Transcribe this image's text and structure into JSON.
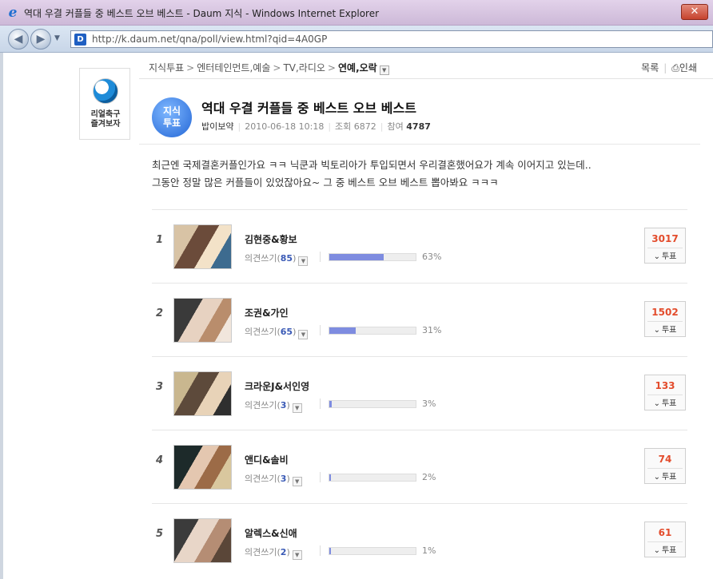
{
  "window": {
    "title": "역대 우결 커플들 중 베스트 오브 베스트 - Daum 지식 - Windows Internet Explorer",
    "url_domain": "http://k.daum.net",
    "url_path": "/qna/poll/view.html?qid=4A0GP",
    "close_label": "✕"
  },
  "side_badge": {
    "line1": "리얼축구",
    "line2": "즐겨보자"
  },
  "breadcrumb": {
    "items": [
      "지식투표",
      "엔터테인먼트,예술",
      "TV,라디오",
      "연예,오락"
    ],
    "separator": ">"
  },
  "actions": {
    "list_label": "목록",
    "print_label": "인쇄"
  },
  "question": {
    "badge_line1": "지식",
    "badge_line2": "투표",
    "title": "역대 우결 커플들 중 베스트 오브 베스트",
    "author": "밥이보약",
    "date": "2010-06-18 10:18",
    "views_label": "조회",
    "views": "6872",
    "participants_label": "참여",
    "participants": "4787",
    "desc_line1": "최근엔 국제결혼커플인가요 ㅋㅋ 닉쿤과 빅토리아가 투입되면서 우리결혼했어요가 계속 이어지고 있는데..",
    "desc_line2": "그동안 정말 많은 커플들이 있었잖아요~ 그 중 베스트 오브 베스트 뽑아봐요 ㅋㅋㅋ"
  },
  "poll": {
    "opinion_label": "의견쓰기",
    "vote_label": "투표",
    "items": [
      {
        "rank": "1",
        "name": "김현중&황보",
        "opinions": "85",
        "percent": "63%",
        "ratio": 0.63,
        "votes": "3017"
      },
      {
        "rank": "2",
        "name": "조권&가인",
        "opinions": "65",
        "percent": "31%",
        "ratio": 0.31,
        "votes": "1502"
      },
      {
        "rank": "3",
        "name": "크라운J&서인영",
        "opinions": "3",
        "percent": "3%",
        "ratio": 0.03,
        "votes": "133"
      },
      {
        "rank": "4",
        "name": "앤디&솔비",
        "opinions": "3",
        "percent": "2%",
        "ratio": 0.02,
        "votes": "74"
      },
      {
        "rank": "5",
        "name": "알렉스&신애",
        "opinions": "2",
        "percent": "1%",
        "ratio": 0.01,
        "votes": "61"
      }
    ]
  },
  "colors": {
    "accent": "#2366d6",
    "bar": "#7e8ce0",
    "vote_count": "#e34c2c"
  }
}
